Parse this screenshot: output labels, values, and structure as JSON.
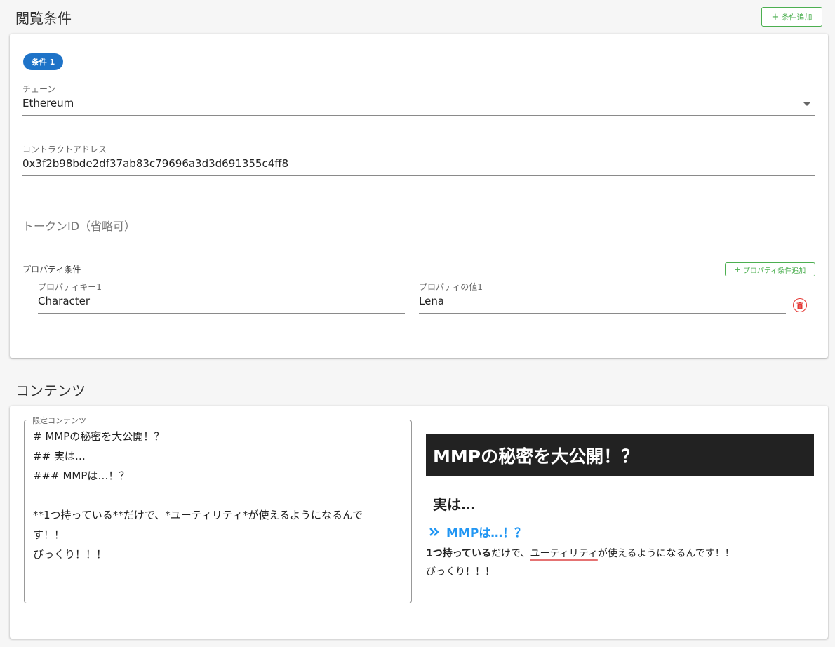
{
  "viewing_conditions": {
    "title": "閲覧条件",
    "add_condition_label": "条件追加",
    "condition": {
      "chip_label": "条件 1",
      "chain": {
        "label": "チェーン",
        "value": "Ethereum"
      },
      "contract_address": {
        "label": "コントラクトアドレス",
        "value": "0x3f2b98bde2df37ab83c79696a3d3d691355c4ff8"
      },
      "token_id": {
        "placeholder": "トークンID（省略可）"
      },
      "property_conditions": {
        "label": "プロパティ条件",
        "add_label": "プロパティ条件追加",
        "items": [
          {
            "key_label": "プロパティキー1",
            "key_value": "Character",
            "value_label": "プロパティの値1",
            "value_value": "Lena"
          }
        ]
      }
    }
  },
  "contents": {
    "title": "コンテンツ",
    "editor": {
      "legend": "限定コンテンツ",
      "lines": [
        "# MMPの秘密を大公開！？",
        "## 実は…",
        "### MMPは…！？",
        "",
        "**1つ持っている**だけで、*ユーティリティ*が使えるようになるんで",
        "す！！",
        "びっくり！！！"
      ]
    },
    "preview": {
      "h1": "MMPの秘密を大公開！？",
      "h2": "実は…",
      "h3": "MMPは…！？",
      "p_bold": "1つ持っている",
      "p_text1": "だけで、",
      "p_em": "ユーティリティ",
      "p_text2": "が使えるようになるんです！！",
      "p_line2": "びっくり！！！"
    }
  },
  "colors": {
    "accent_green": "#4caf50",
    "chip_blue": "#1e73c8",
    "delete_red": "#e53935",
    "h3_blue": "#2196f3"
  },
  "icons": [
    "plus-icon",
    "dropdown-arrow-icon",
    "trash-icon",
    "double-chevron-right-icon"
  ]
}
